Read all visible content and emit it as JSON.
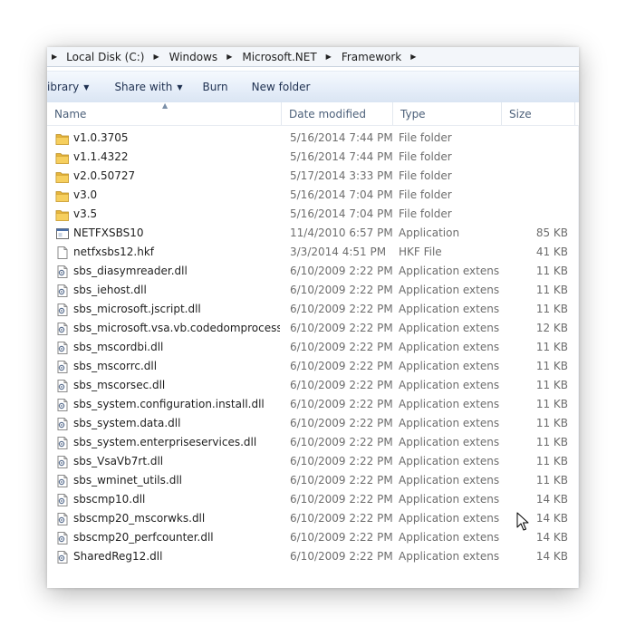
{
  "address": {
    "crumbs": [
      "Local Disk (C:)",
      "Windows",
      "Microsoft.NET",
      "Framework"
    ],
    "icons": {
      "separator": "chevron-right-icon"
    }
  },
  "toolbar": {
    "library_label": "ibrary",
    "share_label": "Share with",
    "burn_label": "Burn",
    "new_folder_label": "New folder"
  },
  "columns": {
    "name": "Name",
    "date": "Date modified",
    "type": "Type",
    "size": "Size"
  },
  "files": [
    {
      "name": "v1.0.3705",
      "date": "5/16/2014 7:44 PM",
      "type": "File folder",
      "size": "",
      "icon": "folder-icon"
    },
    {
      "name": "v1.1.4322",
      "date": "5/16/2014 7:44 PM",
      "type": "File folder",
      "size": "",
      "icon": "folder-icon"
    },
    {
      "name": "v2.0.50727",
      "date": "5/17/2014 3:33 PM",
      "type": "File folder",
      "size": "",
      "icon": "folder-icon"
    },
    {
      "name": "v3.0",
      "date": "5/16/2014 7:04 PM",
      "type": "File folder",
      "size": "",
      "icon": "folder-icon"
    },
    {
      "name": "v3.5",
      "date": "5/16/2014 7:04 PM",
      "type": "File folder",
      "size": "",
      "icon": "folder-icon"
    },
    {
      "name": "NETFXSBS10",
      "date": "11/4/2010 6:57 PM",
      "type": "Application",
      "size": "85 KB",
      "icon": "application-icon"
    },
    {
      "name": "netfxsbs12.hkf",
      "date": "3/3/2014 4:51 PM",
      "type": "HKF File",
      "size": "41 KB",
      "icon": "file-icon"
    },
    {
      "name": "sbs_diasymreader.dll",
      "date": "6/10/2009 2:22 PM",
      "type": "Application extens...",
      "size": "11 KB",
      "icon": "dll-icon"
    },
    {
      "name": "sbs_iehost.dll",
      "date": "6/10/2009 2:22 PM",
      "type": "Application extens...",
      "size": "11 KB",
      "icon": "dll-icon"
    },
    {
      "name": "sbs_microsoft.jscript.dll",
      "date": "6/10/2009 2:22 PM",
      "type": "Application extens...",
      "size": "11 KB",
      "icon": "dll-icon"
    },
    {
      "name": "sbs_microsoft.vsa.vb.codedomprocessor....",
      "date": "6/10/2009 2:22 PM",
      "type": "Application extens...",
      "size": "12 KB",
      "icon": "dll-icon"
    },
    {
      "name": "sbs_mscordbi.dll",
      "date": "6/10/2009 2:22 PM",
      "type": "Application extens...",
      "size": "11 KB",
      "icon": "dll-icon"
    },
    {
      "name": "sbs_mscorrc.dll",
      "date": "6/10/2009 2:22 PM",
      "type": "Application extens...",
      "size": "11 KB",
      "icon": "dll-icon"
    },
    {
      "name": "sbs_mscorsec.dll",
      "date": "6/10/2009 2:22 PM",
      "type": "Application extens...",
      "size": "11 KB",
      "icon": "dll-icon"
    },
    {
      "name": "sbs_system.configuration.install.dll",
      "date": "6/10/2009 2:22 PM",
      "type": "Application extens...",
      "size": "11 KB",
      "icon": "dll-icon"
    },
    {
      "name": "sbs_system.data.dll",
      "date": "6/10/2009 2:22 PM",
      "type": "Application extens...",
      "size": "11 KB",
      "icon": "dll-icon"
    },
    {
      "name": "sbs_system.enterpriseservices.dll",
      "date": "6/10/2009 2:22 PM",
      "type": "Application extens...",
      "size": "11 KB",
      "icon": "dll-icon"
    },
    {
      "name": "sbs_VsaVb7rt.dll",
      "date": "6/10/2009 2:22 PM",
      "type": "Application extens...",
      "size": "11 KB",
      "icon": "dll-icon"
    },
    {
      "name": "sbs_wminet_utils.dll",
      "date": "6/10/2009 2:22 PM",
      "type": "Application extens...",
      "size": "11 KB",
      "icon": "dll-icon"
    },
    {
      "name": "sbscmp10.dll",
      "date": "6/10/2009 2:22 PM",
      "type": "Application extens...",
      "size": "14 KB",
      "icon": "dll-icon"
    },
    {
      "name": "sbscmp20_mscorwks.dll",
      "date": "6/10/2009 2:22 PM",
      "type": "Application extens...",
      "size": "14 KB",
      "icon": "dll-icon"
    },
    {
      "name": "sbscmp20_perfcounter.dll",
      "date": "6/10/2009 2:22 PM",
      "type": "Application extens...",
      "size": "14 KB",
      "icon": "dll-icon"
    },
    {
      "name": "SharedReg12.dll",
      "date": "6/10/2009 2:22 PM",
      "type": "Application extens...",
      "size": "14 KB",
      "icon": "dll-icon"
    }
  ],
  "colors": {
    "folder": "#e7b53c",
    "toolbar_text": "#1e3050",
    "header_text": "#4c607a",
    "meta_text": "#6d6d6d"
  }
}
